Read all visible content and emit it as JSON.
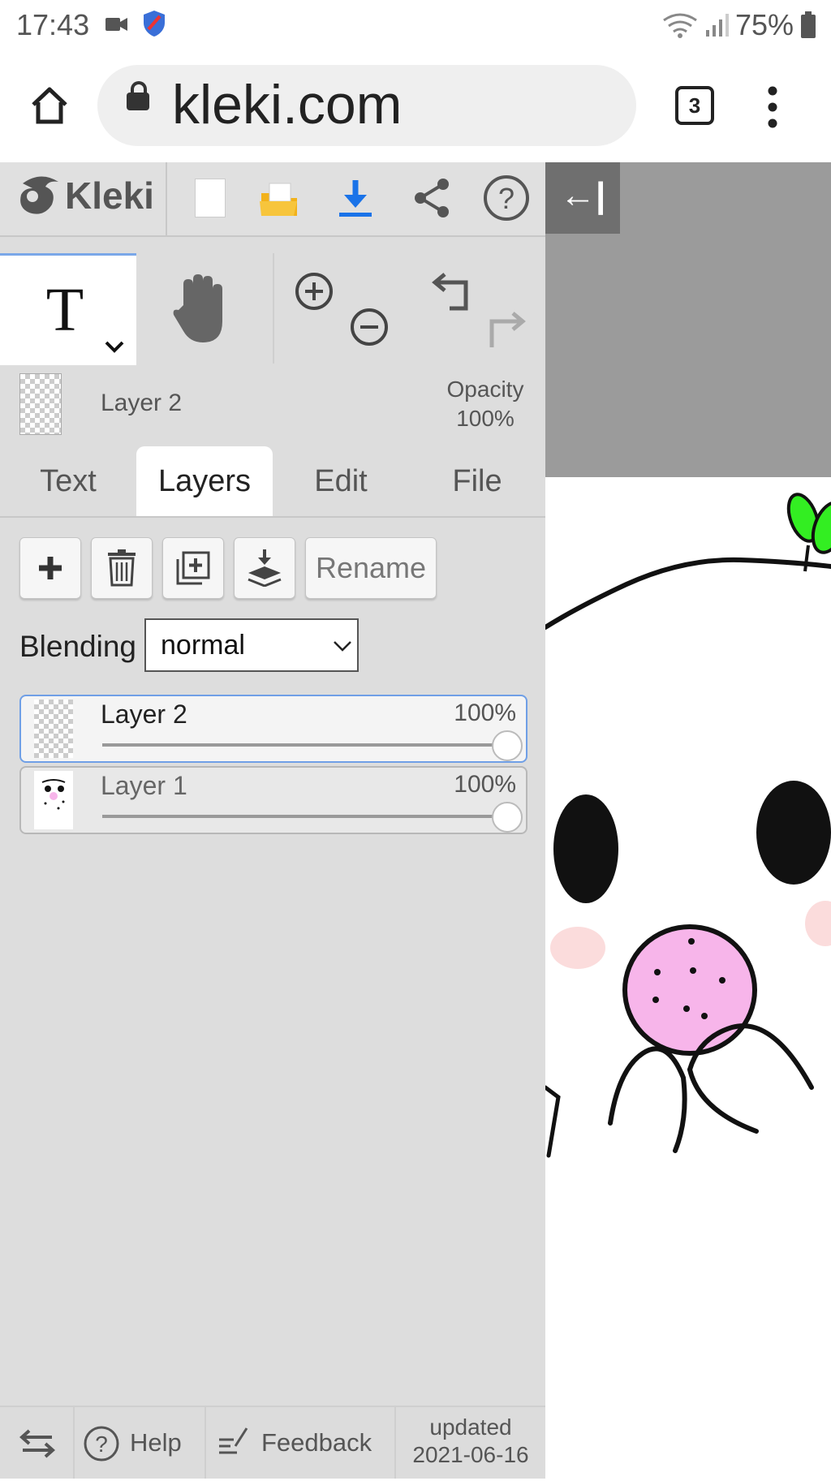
{
  "status_bar": {
    "time": "17:43",
    "battery": "75%"
  },
  "browser": {
    "url": "kleki.com",
    "tab_count": "3"
  },
  "app": {
    "logo": "Kleki",
    "collapse_label": "←|",
    "current_layer": {
      "name": "Layer 2",
      "opacity_label": "Opacity",
      "opacity_value": "100%"
    },
    "tabs": [
      "Text",
      "Layers",
      "Edit",
      "File"
    ],
    "active_tab": "Layers",
    "layer_buttons": {
      "rename": "Rename"
    },
    "blending": {
      "label": "Blending",
      "value": "normal"
    },
    "layers": [
      {
        "name": "Layer 2",
        "opacity": "100%",
        "selected": true
      },
      {
        "name": "Layer 1",
        "opacity": "100%",
        "selected": false
      }
    ],
    "footer": {
      "help": "Help",
      "feedback": "Feedback",
      "updated_label": "updated",
      "updated_date": "2021-06-16"
    }
  },
  "colors": {
    "accent_blue": "#1a73e8",
    "folder_yellow": "#f2b21b",
    "selection_border": "#6f9fe6",
    "nose_pink": "#f7b5ea",
    "leaf_green": "#33ee22"
  },
  "icons": [
    "camera-icon",
    "shield-icon",
    "wifi-icon",
    "signal-icon",
    "battery-icon",
    "home-icon",
    "lock-icon",
    "more-vert-icon",
    "new-file-icon",
    "folder-icon",
    "download-icon",
    "share-icon",
    "help-icon",
    "text-tool-icon",
    "hand-icon",
    "zoom-in-icon",
    "zoom-out-icon",
    "undo-icon",
    "redo-icon",
    "plus-icon",
    "trash-icon",
    "duplicate-icon",
    "merge-down-icon",
    "swap-icon",
    "feedback-icon"
  ]
}
